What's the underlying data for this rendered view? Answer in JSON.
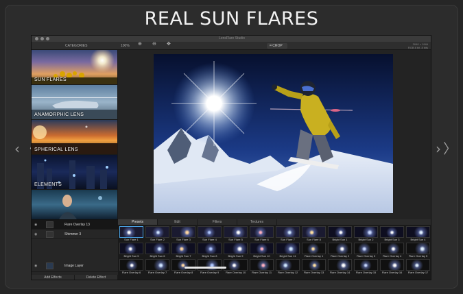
{
  "headline": "REAL SUN FLARES",
  "app": {
    "title": "LensFlare Studio",
    "toolbar": {
      "categories_label": "CATEGORIES",
      "zoom": "100%",
      "crop_label": "CROP",
      "info_line1": "3040 × 1946",
      "info_line2": "RGB 8 bit, 8 bits"
    },
    "categories": [
      {
        "label": "SUN FLARES"
      },
      {
        "label": "ANAMORPHIC LENS"
      },
      {
        "label": "SPHERICAL LENS"
      },
      {
        "label": "ELEMENTS"
      },
      {
        "label": ""
      }
    ],
    "layers": [
      {
        "name": "Flare Overlay 13"
      },
      {
        "name": "Shimmer 3"
      },
      {
        "name": "Image Layer"
      }
    ],
    "buttons": {
      "add_effects": "Add Effects",
      "delete_effect": "Delete Effect"
    },
    "tabs": [
      "Presets",
      "Edit",
      "Filters",
      "Textures"
    ],
    "presets": [
      "Sun Flare 1",
      "Sun Flare 2",
      "Sun Flare 3",
      "Sun Flare 4",
      "Sun Flare 5",
      "Sun Flare 6",
      "Sun Flare 7",
      "Sun Flare 8",
      "Bright Sun 1",
      "Bright Sun 2",
      "Bright Sun 3",
      "Bright Sun 4",
      "Bright Sun 5",
      "Bright Sun 6",
      "Bright Sun 7",
      "Bright Sun 8",
      "Bright Sun 9",
      "Bright Sun 10",
      "Bright Sun 11",
      "Flare Overlay 1",
      "Flare Overlay 2",
      "Flare Overlay 3",
      "Flare Overlay 4",
      "Flare Overlay 5",
      "Flare Overlay 6",
      "Flare Overlay 7",
      "Flare Overlay 8",
      "Flare Overlay 9",
      "Flare Overlay 10",
      "Flare Overlay 11",
      "Flare Overlay 12",
      "Flare Overlay 13",
      "Flare Overlay 14",
      "Flare Overlay 15",
      "Flare Overlay 16",
      "Flare Overlay 17"
    ]
  },
  "colors": {
    "accent": "#4aa0e0",
    "jacket": "#c9b020",
    "sky": "#0a1640"
  },
  "icons": [
    "zoom-in-icon",
    "zoom-out-icon",
    "move-icon",
    "crop-icon",
    "eye-icon",
    "chevron-left-icon",
    "chevron-right-icon"
  ]
}
